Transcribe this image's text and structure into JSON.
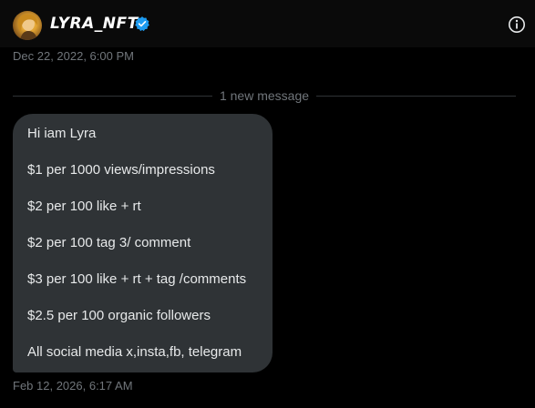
{
  "header": {
    "title": "LYRA_NFT",
    "verified_color": "#1d9bf0",
    "avatar_icon": "user-avatar",
    "info_icon": "info-circle-icon"
  },
  "conversation": {
    "first_timestamp": "Dec 22, 2022, 6:00 PM",
    "divider_label": "1 new message",
    "message_lines": [
      "Hi iam Lyra",
      "$1 per 1000 views/impressions",
      "$2 per 100 like + rt",
      "$2 per 100 tag 3/ comment",
      "$3 per 100 like + rt + tag /comments",
      "$2.5 per 100 organic followers",
      "All social media x,insta,fb, telegram"
    ],
    "message_timestamp": "Feb 12, 2026, 6:17 AM"
  }
}
